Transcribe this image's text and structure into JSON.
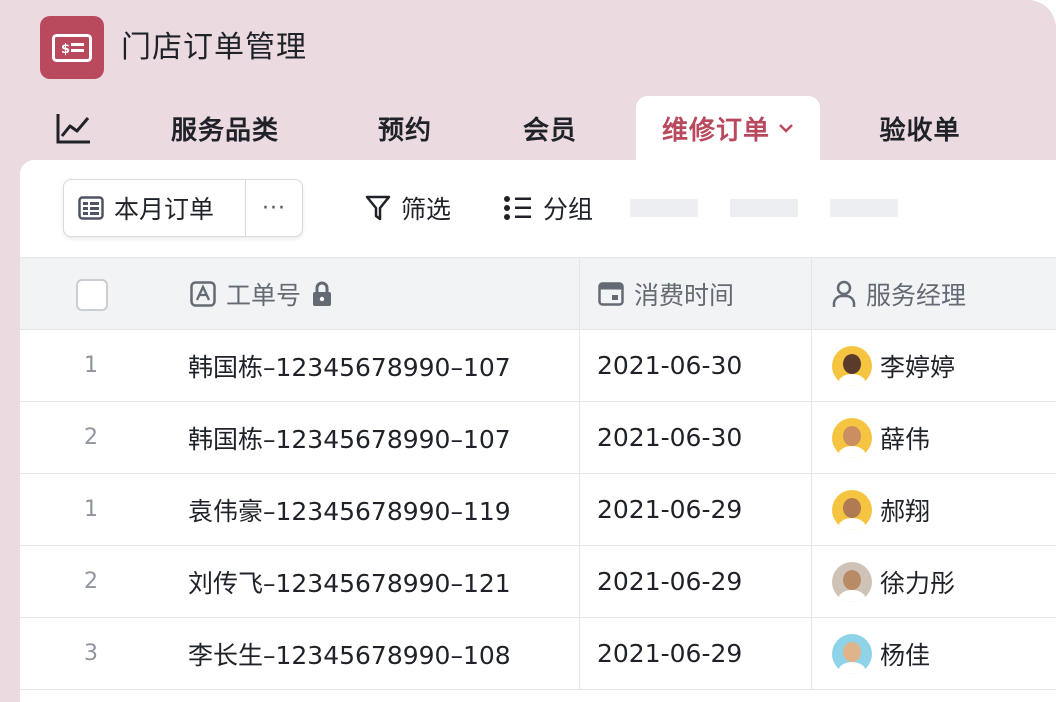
{
  "header": {
    "app_title": "门店订单管理",
    "logo_icon": "ticket-icon",
    "accent_color": "#b94a5e"
  },
  "tabs": [
    {
      "label": "",
      "icon": "line-chart-icon"
    },
    {
      "label": "服务品类"
    },
    {
      "label": "预约"
    },
    {
      "label": "会员"
    },
    {
      "label": "维修订单",
      "active": true,
      "icon": "chevron-down-icon"
    },
    {
      "label": "验收单"
    }
  ],
  "toolbar": {
    "view_label": "本月订单",
    "view_icon": "table-view-icon",
    "more_label": "···",
    "filter_label": "筛选",
    "group_label": "分组"
  },
  "table": {
    "columns": [
      {
        "label": "工单号",
        "icon": "text-field-icon",
        "locked": true
      },
      {
        "label": "消费时间",
        "icon": "date-field-icon"
      },
      {
        "label": "服务经理",
        "icon": "person-field-icon"
      }
    ],
    "rows": [
      {
        "index": "1",
        "order": "韩国栋–12345678990–107",
        "date": "2021-06-30",
        "manager": "李婷婷",
        "avatar_bg": "#f5c542",
        "skin": "#5a3a2a"
      },
      {
        "index": "2",
        "order": "韩国栋–12345678990–107",
        "date": "2021-06-30",
        "manager": "薛伟",
        "avatar_bg": "#f5c542",
        "skin": "#c98e62"
      },
      {
        "index": "1",
        "order": "袁伟豪–12345678990–119",
        "date": "2021-06-29",
        "manager": "郝翔",
        "avatar_bg": "#f5c542",
        "skin": "#b07a52"
      },
      {
        "index": "2",
        "order": "刘传飞–12345678990–121",
        "date": "2021-06-29",
        "manager": "徐力彤",
        "avatar_bg": "#cfc3b8",
        "skin": "#b98a66"
      },
      {
        "index": "3",
        "order": "李长生–12345678990–108",
        "date": "2021-06-29",
        "manager": "杨佳",
        "avatar_bg": "#8fd3e8",
        "skin": "#e0b48a"
      }
    ]
  }
}
